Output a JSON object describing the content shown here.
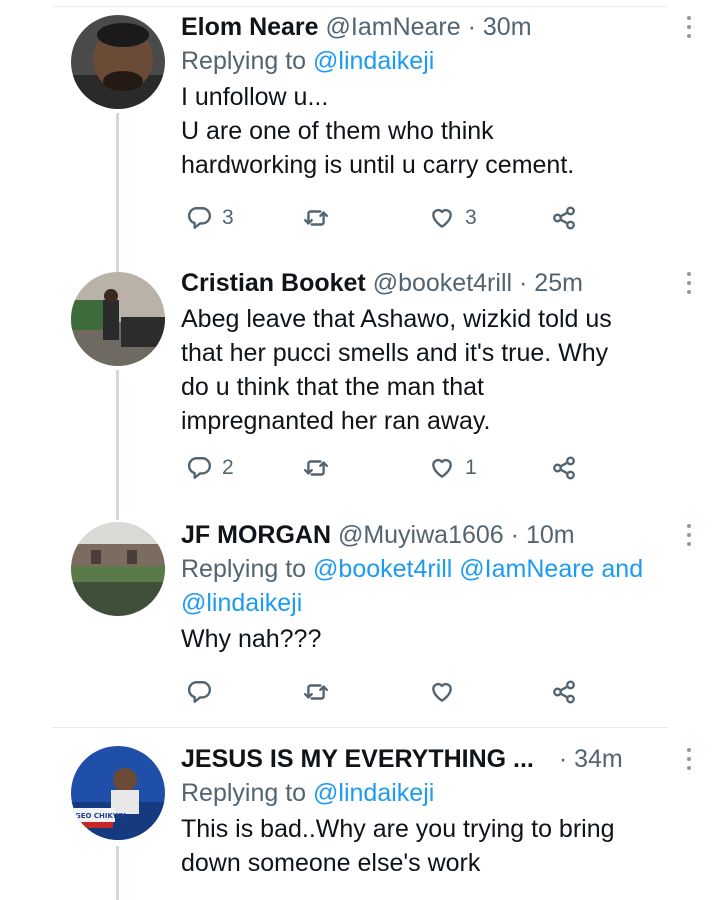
{
  "colors": {
    "link": "#1d9bf0",
    "muted": "#536471",
    "text": "#0f1419",
    "thread_line": "#cfd9de"
  },
  "tweets": [
    {
      "name": "Elom Neare",
      "handle": "@IamNeare",
      "dot": "·",
      "time": "30m",
      "reply_prefix": "Replying to",
      "reply_mentions": "@lindaikeji",
      "lines": [
        "I unfollow u...",
        "U are one of them who think",
        "hardworking is until u carry cement."
      ],
      "replies": "3",
      "retweets": "",
      "likes": "3"
    },
    {
      "name": "Cristian Booket",
      "handle": "@booket4rill",
      "dot": "·",
      "time": "25m",
      "lines": [
        "Abeg leave that Ashawo, wizkid told us",
        "that her pucci smells and it's true. Why",
        "do u think that the man that",
        "impregnanted her ran away."
      ],
      "replies": "2",
      "retweets": "",
      "likes": "1"
    },
    {
      "name": "JF MORGAN",
      "handle": "@Muyiwa1606",
      "dot": "·",
      "time": "10m",
      "reply_prefix": "Replying to",
      "reply_mentions": "@booket4rill @IamNeare and",
      "reply_mentions_2": "@lindaikeji",
      "lines": [
        "Why nah???"
      ],
      "replies": "",
      "retweets": "",
      "likes": ""
    },
    {
      "name": "JESUS IS MY EVERYTHING ...",
      "handle": "",
      "dot": "·",
      "time": "34m",
      "reply_prefix": "Replying to",
      "reply_mentions": "@lindaikeji",
      "lines": [
        "This is bad..Why are you trying to bring",
        "down someone else's work"
      ],
      "avatar_badge": "GEO CHIKWY"
    }
  ]
}
